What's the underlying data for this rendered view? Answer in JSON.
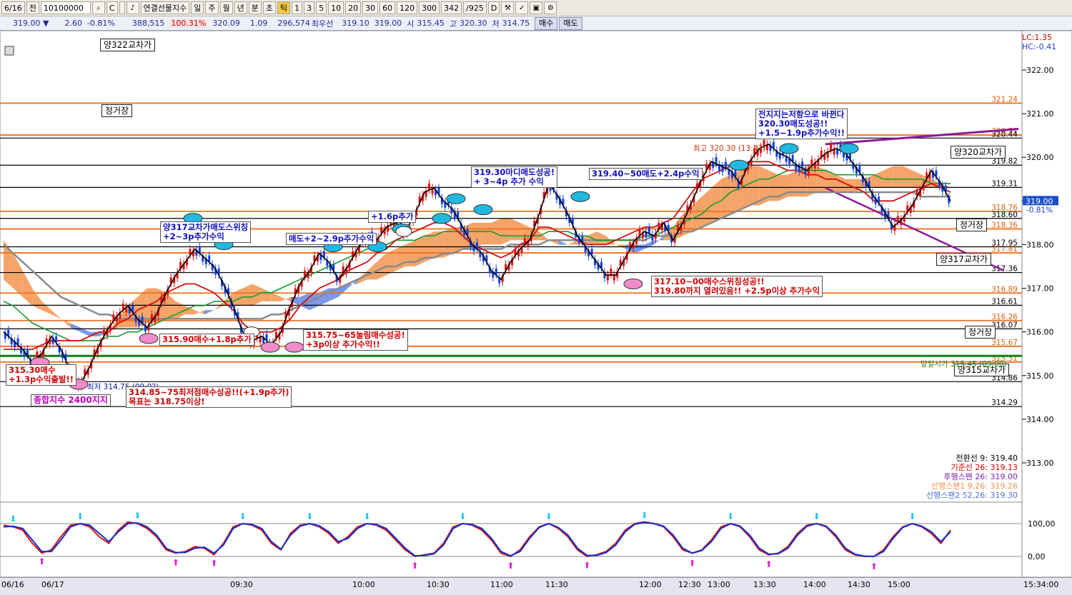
{
  "toolbar": {
    "items": [
      "6/16",
      "전",
      "10100000",
      "C",
      "",
      "연결선물지수",
      "일",
      "주",
      "월",
      "년",
      "분",
      "초",
      "틱",
      "1",
      "3",
      "5",
      "10",
      "20",
      "30",
      "60",
      "120",
      "300",
      "342",
      "/925",
      "D"
    ],
    "selected": "틱"
  },
  "quote": {
    "price": "319.00 ▼",
    "change": "2.60",
    "change_pct": "-0.81%",
    "volume": "388,515",
    "vol_pct": "100.31%",
    "v1": "320.09",
    "v2": "1.09",
    "v3": "296,574",
    "best_label": "최우선",
    "best_bid": "319.10",
    "best_ask": "319.00",
    "open_label": "시",
    "open": "315.45",
    "high_label": "고",
    "high": "320.30",
    "low_label": "저",
    "low": "314.75",
    "buy_btn": "매수",
    "sell_btn": "매도"
  },
  "corner": {
    "lc": "LC:1.35",
    "hc": "HC:-0.41"
  },
  "chart_data": {
    "type": "line",
    "ylim": [
      313.2,
      322.8
    ],
    "y_ticks": [
      "322.00",
      "321.00",
      "320.00",
      "319.00",
      "318.00",
      "317.00",
      "316.00",
      "315.00",
      "314.00",
      "313.00"
    ],
    "current_price": "319.00",
    "current_pct": "-0.81%",
    "hlines": [
      {
        "value": 321.24,
        "label": "321.24",
        "color": "#f07020"
      },
      {
        "value": 320.51,
        "label": "320.51",
        "color": "#f07020"
      },
      {
        "value": 320.44,
        "label": "320.44",
        "color": "#000000"
      },
      {
        "value": 319.82,
        "label": "319.82",
        "color": "#000000"
      },
      {
        "value": 319.31,
        "label": "319.31",
        "color": "#000000"
      },
      {
        "value": 318.76,
        "label": "318.76",
        "color": "#f07020"
      },
      {
        "value": 318.6,
        "label": "318.60",
        "color": "#000000"
      },
      {
        "value": 318.36,
        "label": "318.36",
        "color": "#f07020"
      },
      {
        "value": 317.95,
        "label": "317.95",
        "color": "#000000"
      },
      {
        "value": 317.81,
        "label": "317.81",
        "color": "#f07020"
      },
      {
        "value": 317.36,
        "label": "317.36",
        "color": "#000000"
      },
      {
        "value": 316.89,
        "label": "316.89",
        "color": "#f07020"
      },
      {
        "value": 316.61,
        "label": "316.61",
        "color": "#000000"
      },
      {
        "value": 316.26,
        "label": "316.26",
        "color": "#f07020"
      },
      {
        "value": 316.07,
        "label": "316.07",
        "color": "#000000"
      },
      {
        "value": 315.67,
        "label": "315.67",
        "color": "#f07020"
      },
      {
        "value": 315.31,
        "label": "315.31",
        "color": "#f07020"
      },
      {
        "value": 314.86,
        "label": "314.86",
        "color": "#000000"
      },
      {
        "value": 314.29,
        "label": "314.29",
        "color": "#000000"
      }
    ],
    "x_labels": [
      "06/16",
      "06/17",
      "09:30",
      "10:00",
      "10:30",
      "11:00",
      "11:30",
      "12:00",
      "12:30",
      "13:00",
      "13:30",
      "14:00",
      "14:30",
      "15:00",
      "15:34:00"
    ],
    "price_path": [
      316.0,
      315.8,
      315.6,
      315.3,
      315.5,
      315.9,
      315.6,
      315.1,
      314.8,
      315.2,
      315.7,
      316.1,
      316.4,
      316.6,
      316.3,
      316.1,
      316.4,
      316.9,
      317.3,
      317.6,
      317.9,
      317.7,
      317.5,
      317.1,
      316.6,
      316.0,
      315.8,
      315.9,
      315.7,
      316.0,
      316.6,
      317.1,
      317.4,
      317.8,
      317.6,
      317.2,
      317.5,
      317.9,
      318.2,
      318.1,
      318.4,
      318.5,
      318.3,
      318.7,
      319.2,
      319.3,
      319.0,
      318.8,
      318.4,
      318.0,
      317.8,
      317.4,
      317.2,
      317.6,
      317.9,
      318.1,
      318.7,
      319.4,
      319.1,
      318.7,
      318.2,
      317.9,
      317.6,
      317.3,
      317.3,
      317.7,
      318.1,
      318.3,
      318.2,
      318.5,
      318.1,
      318.5,
      319.0,
      319.5,
      319.9,
      319.8,
      319.7,
      319.4,
      319.9,
      320.2,
      320.3,
      320.1,
      320.0,
      319.8,
      319.7,
      319.9,
      320.1,
      320.2,
      320.1,
      319.8,
      319.5,
      319.1,
      318.8,
      318.4,
      318.6,
      318.9,
      319.3,
      319.7,
      319.4,
      319.0
    ],
    "red_line": [
      315.6,
      315.6,
      315.6,
      315.6,
      315.7,
      315.8,
      315.8,
      315.8,
      315.8,
      315.9,
      316.0,
      316.0,
      316.2,
      316.3,
      316.5,
      316.6,
      316.7,
      316.9,
      317.0,
      317.1,
      317.1,
      317.0,
      316.9,
      316.7,
      316.5,
      316.2,
      316.0,
      316.0,
      316.0,
      316.1,
      316.3,
      316.6,
      316.8,
      317.0,
      317.1,
      317.2,
      317.4,
      317.5,
      317.6,
      317.8,
      317.9,
      318.1,
      318.2,
      318.3,
      318.4,
      318.5,
      318.5,
      318.4,
      318.2,
      318.0,
      317.9,
      317.8,
      317.7,
      317.8,
      318.0,
      318.1,
      318.4,
      318.4,
      318.3,
      318.2,
      318.1,
      318.0,
      318.0,
      318.0,
      318.1,
      318.2,
      318.3,
      318.4,
      318.4,
      318.5,
      318.6,
      318.9,
      319.2,
      319.5,
      319.6,
      319.7,
      319.8,
      319.8,
      319.9,
      319.9,
      319.9,
      319.8,
      319.7,
      319.7,
      319.6,
      319.6,
      319.5,
      319.5,
      319.4,
      319.3,
      319.2,
      319.0,
      319.0,
      319.0,
      319.1,
      319.2,
      319.3,
      319.4,
      319.3,
      319.2
    ],
    "green_line": [
      316.7,
      316.6,
      316.4,
      316.2,
      316.1,
      316.0,
      315.9,
      315.8,
      315.8,
      315.8,
      315.8,
      315.9,
      315.9,
      316.0,
      316.0,
      316.1,
      316.2,
      316.3,
      316.4,
      316.5,
      316.6,
      316.6,
      316.7,
      316.7,
      316.7,
      316.8,
      316.8,
      316.9,
      316.9,
      317.0,
      317.1,
      317.2,
      317.3,
      317.4,
      317.5,
      317.6,
      317.7,
      317.8,
      317.9,
      318.0,
      318.0,
      318.1,
      318.1,
      318.1,
      318.2,
      318.2,
      318.3,
      318.3,
      318.3,
      318.3,
      318.3,
      318.3,
      318.2,
      318.2,
      318.2,
      318.2,
      318.2,
      318.3,
      318.3,
      318.3,
      318.2,
      318.2,
      318.1,
      318.1,
      318.1,
      318.1,
      318.1,
      318.2,
      318.2,
      318.3,
      318.4,
      318.5,
      318.6,
      318.7,
      318.9,
      319.0,
      319.2,
      319.3,
      319.4,
      319.5,
      319.5,
      319.6,
      319.7,
      319.7,
      319.7,
      319.7,
      319.7,
      319.6,
      319.6,
      319.6,
      319.6,
      319.6,
      319.5,
      319.5,
      319.5,
      319.5,
      319.5,
      319.4,
      319.4,
      319.4
    ],
    "gray_line": [
      318.0,
      317.8,
      317.6,
      317.4,
      317.2,
      317.0,
      316.8,
      316.7,
      316.6,
      316.5,
      316.4,
      316.4,
      316.3,
      316.3,
      316.3,
      316.3,
      316.3,
      316.3,
      316.3,
      316.3,
      316.3,
      316.3,
      316.3,
      316.3,
      316.3,
      316.3,
      316.3,
      316.3,
      316.4,
      316.4,
      316.5,
      316.6,
      316.7,
      316.8,
      316.9,
      317.0,
      317.1,
      317.2,
      317.3,
      317.4,
      317.5,
      317.5,
      317.6,
      317.6,
      317.7,
      317.7,
      317.8,
      317.8,
      317.9,
      317.9,
      317.9,
      317.9,
      317.9,
      318.0,
      318.0,
      318.0,
      318.0,
      318.1,
      318.1,
      318.1,
      318.1,
      318.1,
      318.1,
      318.1,
      318.1,
      318.1,
      318.1,
      318.1,
      318.2,
      318.2,
      318.2,
      318.3,
      318.3,
      318.4,
      318.5,
      318.6,
      318.7,
      318.8,
      318.9,
      319.0,
      319.1,
      319.1,
      319.2,
      319.2,
      319.2,
      319.2,
      319.2,
      319.2,
      319.2,
      319.2,
      319.2,
      319.2,
      319.2,
      319.2,
      319.2,
      319.2,
      319.1,
      319.1,
      319.1,
      319.1
    ],
    "cloud_a": [
      318.1,
      317.8,
      317.4,
      317.0,
      316.7,
      316.5,
      316.3,
      316.1,
      316.0,
      315.9,
      315.9,
      316.0,
      316.3,
      316.6,
      316.8,
      317.0,
      317.0,
      316.9,
      316.7,
      316.6,
      316.5,
      316.4,
      316.5,
      316.7,
      316.9,
      317.0,
      317.1,
      317.0,
      316.9,
      316.8,
      316.7,
      316.6,
      316.5,
      316.6,
      316.7,
      316.8,
      317.0,
      317.2,
      317.4,
      317.6,
      317.8,
      317.9,
      318.0,
      318.1,
      318.2,
      318.3,
      318.3,
      318.4,
      318.4,
      318.5,
      318.5,
      318.5,
      318.6,
      318.6,
      318.5,
      318.4,
      318.3,
      318.1,
      318.0,
      318.0,
      318.1,
      318.2,
      318.3,
      318.2,
      318.0,
      317.9,
      317.8,
      317.9,
      318.0,
      318.2,
      318.4,
      318.7,
      318.9,
      319.1,
      319.3,
      319.5,
      319.6,
      319.7,
      319.8,
      319.8,
      319.7,
      319.6,
      319.6,
      319.7,
      319.8,
      319.8,
      319.7,
      319.6,
      319.5,
      319.5,
      319.5,
      319.6,
      319.7,
      319.8,
      319.8,
      319.7,
      319.6,
      319.5,
      319.4,
      319.3
    ],
    "cloud_b": [
      317.2,
      317.0,
      316.8,
      316.6,
      316.5,
      316.4,
      316.3,
      316.2,
      316.1,
      316.0,
      316.0,
      316.0,
      316.1,
      316.1,
      316.1,
      316.2,
      316.2,
      316.3,
      316.3,
      316.4,
      316.4,
      316.5,
      316.5,
      316.6,
      316.6,
      316.6,
      316.6,
      316.7,
      316.7,
      316.7,
      316.8,
      316.8,
      316.9,
      316.9,
      317.0,
      317.0,
      317.1,
      317.1,
      317.2,
      317.2,
      317.3,
      317.4,
      317.5,
      317.5,
      317.6,
      317.7,
      317.7,
      317.8,
      317.9,
      317.9,
      318.0,
      318.0,
      318.0,
      318.1,
      318.1,
      318.1,
      318.1,
      318.1,
      318.1,
      318.0,
      318.0,
      318.0,
      318.0,
      318.0,
      318.0,
      318.0,
      318.0,
      318.0,
      318.1,
      318.1,
      318.1,
      318.2,
      318.3,
      318.4,
      318.5,
      318.6,
      318.7,
      318.8,
      318.9,
      318.9,
      319.0,
      319.0,
      319.1,
      319.1,
      319.1,
      319.2,
      319.2,
      319.2,
      319.2,
      319.2,
      319.3,
      319.3,
      319.3,
      319.3,
      319.3,
      319.3,
      319.3,
      319.3,
      319.3,
      319.3
    ],
    "osc_red": [
      95,
      90,
      80,
      40,
      10,
      20,
      60,
      95,
      100,
      90,
      60,
      40,
      80,
      105,
      100,
      85,
      60,
      20,
      10,
      15,
      30,
      25,
      5,
      40,
      90,
      100,
      95,
      80,
      40,
      20,
      70,
      95,
      100,
      90,
      70,
      40,
      60,
      90,
      100,
      95,
      80,
      50,
      20,
      0,
      5,
      10,
      40,
      90,
      100,
      95,
      80,
      50,
      10,
      0,
      20,
      60,
      90,
      100,
      85,
      60,
      20,
      0,
      5,
      15,
      40,
      80,
      100,
      105,
      100,
      90,
      60,
      20,
      10,
      20,
      50,
      90,
      100,
      90,
      60,
      20,
      5,
      10,
      30,
      70,
      95,
      100,
      90,
      60,
      20,
      5,
      0,
      0,
      20,
      60,
      90,
      100,
      90,
      70,
      40,
      80
    ],
    "osc_blue": [
      90,
      92,
      85,
      50,
      15,
      15,
      50,
      90,
      100,
      95,
      70,
      45,
      75,
      100,
      102,
      90,
      65,
      25,
      12,
      12,
      25,
      28,
      10,
      35,
      85,
      100,
      97,
      85,
      45,
      22,
      65,
      92,
      100,
      93,
      75,
      45,
      55,
      85,
      100,
      97,
      85,
      55,
      25,
      2,
      3,
      8,
      35,
      85,
      100,
      97,
      85,
      55,
      15,
      2,
      15,
      55,
      88,
      100,
      88,
      65,
      25,
      3,
      3,
      12,
      35,
      75,
      98,
      103,
      100,
      92,
      65,
      25,
      10,
      18,
      45,
      85,
      100,
      92,
      65,
      25,
      7,
      8,
      25,
      65,
      92,
      100,
      92,
      65,
      25,
      7,
      1,
      0,
      15,
      55,
      88,
      100,
      92,
      75,
      45,
      75
    ],
    "osc_ticks": [
      "100,00",
      "0,00"
    ],
    "legend": [
      {
        "label": "전환선 9: 319.40",
        "color": "#000000"
      },
      {
        "label": "기준선 26: 319.13",
        "color": "#d00000"
      },
      {
        "label": "후행스팬 26: 319.00",
        "color": "#7a20b0"
      },
      {
        "label": "선행스팬1 9,26: 319.26",
        "color": "#f09050"
      },
      {
        "label": "선행스팬2 52,26: 319.30",
        "color": "#5070e0"
      }
    ]
  },
  "labels": {
    "l322": "양322교차가",
    "jeong1": "정거장",
    "jeong2": "정거장",
    "jeong3": "정거장",
    "l320": "양320교차가",
    "l317": "양317교차가",
    "l315": "양315교차가",
    "kospi": "종합지수 2400지지",
    "high_note": "최고 320.30 (13:47)",
    "low_note": "최저 314.75 (09:0?)",
    "day_high_note": "당일시가 315.45 (09:00)"
  },
  "annotations": {
    "a1": "315.30매수\n+1.3p수익출발!!",
    "a2": "314.85~75최저점매수성공!!(+1.9p추가)\n목표는 318.75이상!",
    "a3": "315.90매수+1.8p추가",
    "a4": "315.75~65눌림매수성공!\n+3p이상 추가수익!!",
    "a5": "양317교차가매도스위칭\n+2~3p추가수익",
    "a6": "매도+2~2.9p추가수익",
    "a7": "+1.6p추가",
    "a8": "319.30마디매도성공!\n+ 3~4p 추가 수익",
    "a9": "319.40~50매도+2.4p수익",
    "a10": "317.10~00매수스위칭성공!!\n319.80까지 열려있음!! +2.5p이상 추가수익",
    "a11": "전지지는저항으로 바뀐다\n320.30매도성공!!\n+1.5~1.9p추가수익!!"
  }
}
